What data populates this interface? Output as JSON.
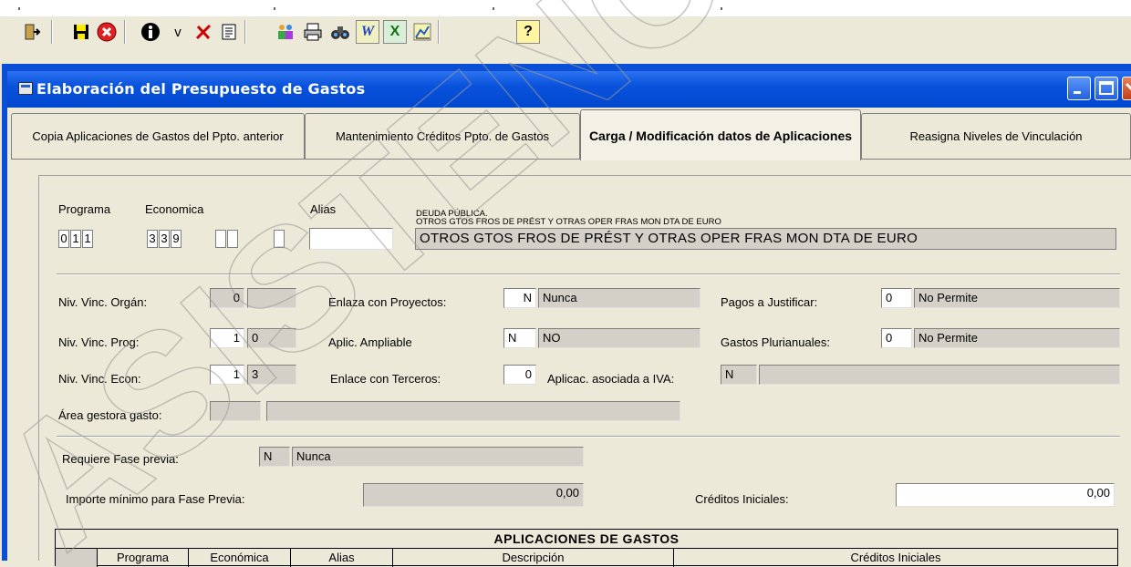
{
  "toolbar": {
    "buttons": [
      {
        "icon": "exit-icon",
        "label": ""
      },
      {
        "icon": "save-icon",
        "label": ""
      },
      {
        "icon": "cancel-icon",
        "label": ""
      },
      {
        "icon": "info-icon",
        "label": ""
      },
      {
        "icon": "check-icon",
        "label": "v"
      },
      {
        "icon": "delete-icon",
        "label": ""
      },
      {
        "icon": "list-icon",
        "label": ""
      },
      {
        "icon": "search-people-icon",
        "label": ""
      },
      {
        "icon": "print-icon",
        "label": ""
      },
      {
        "icon": "binoculars-icon",
        "label": ""
      },
      {
        "icon": "word-icon",
        "label": "W"
      },
      {
        "icon": "excel-icon",
        "label": "X"
      },
      {
        "icon": "chart-icon",
        "label": ""
      },
      {
        "icon": "help-icon",
        "label": "?"
      }
    ]
  },
  "window": {
    "title": "Elaboración del Presupuesto de Gastos"
  },
  "tabs": [
    {
      "label": "Copia Aplicaciones de Gastos del Ppto. anterior",
      "active": false
    },
    {
      "label": "Mantenimiento Créditos Ppto. de Gastos",
      "active": false
    },
    {
      "label": "Carga / Modificación datos de Aplicaciones",
      "active": true
    },
    {
      "label": "Reasigna Niveles de Vinculación",
      "active": false
    }
  ],
  "form": {
    "programa_label": "Programa",
    "economica_label": "Economica",
    "alias_label": "Alias",
    "programa_digits": [
      "0",
      "1",
      "1"
    ],
    "economica_digits": [
      "3",
      "3",
      "9"
    ],
    "alias_value": "",
    "desc_line1": "DEUDA PÚBLICA.",
    "desc_line2": "OTROS GTOS FROS DE PRÉST Y OTRAS OPER FRAS MON DTA DE EURO",
    "desc_full": "OTROS GTOS FROS DE PRÉST Y OTRAS OPER FRAS MON DTA DE EURO",
    "niv_organ_label": "Niv. Vinc. Orgán:",
    "niv_organ_value": "0",
    "niv_organ_extra": "",
    "niv_prog_label": "Niv. Vinc. Prog:",
    "niv_prog_value": "1",
    "niv_prog_extra": "0",
    "niv_econ_label": "Niv. Vinc. Econ:",
    "niv_econ_value": "1",
    "niv_econ_extra": "3",
    "area_label": "Área gestora gasto:",
    "area_code": "",
    "area_desc": "",
    "enlaza_label": "Enlaza con Proyectos:",
    "enlaza_code": "N",
    "enlaza_desc": "Nunca",
    "ampliable_label": "Aplic. Ampliable",
    "ampliable_code": "N",
    "ampliable_desc": "NO",
    "terceros_label": "Enlace con Terceros:",
    "terceros_value": "0",
    "iva_label": "Aplicac. asociada a IVA:",
    "iva_code": "N",
    "iva_desc": "",
    "pagos_label": "Pagos a Justificar:",
    "pagos_code": "0",
    "pagos_desc": "No Permite",
    "pluri_label": "Gastos Plurianuales:",
    "pluri_code": "0",
    "pluri_desc": "No Permite",
    "fase_label": "Requiere Fase previa:",
    "fase_code": "N",
    "fase_desc": "Nunca",
    "importe_label": "Importe mínimo para Fase Previa:",
    "importe_value": "0,00",
    "creditos_label": "Créditos Iniciales:",
    "creditos_value": "0,00"
  },
  "table": {
    "title": "APLICACIONES DE GASTOS",
    "headers": [
      "",
      "Programa",
      "Económica",
      "Alias",
      "Descripción",
      "Créditos Iniciales"
    ]
  },
  "watermark": "ASISTENCIA"
}
